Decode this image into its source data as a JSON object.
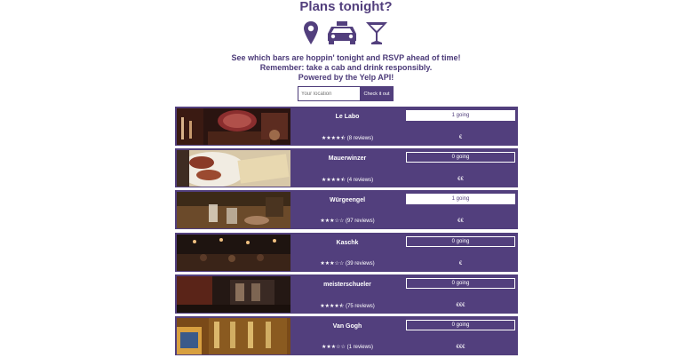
{
  "header": {
    "title": "Plans tonight?",
    "line1": "See which bars are hoppin' tonight and RSVP ahead of time!",
    "line2": "Remember: take a cab and drink responsibly.",
    "line3": "Powered by the Yelp API!"
  },
  "icons": [
    "map-marker-icon",
    "taxi-icon",
    "cocktail-icon"
  ],
  "search": {
    "placeholder": "Your location",
    "button_label": "Check it out"
  },
  "colors": {
    "brand": "#523f7d",
    "card": "#523f7d",
    "text": "#ffffff"
  },
  "bars": [
    {
      "name": "Le Labo",
      "stars": "★★★★⯪",
      "reviews": "(8 reviews)",
      "going": "1 going",
      "active": true,
      "price": "€"
    },
    {
      "name": "Mauerwinzer",
      "stars": "★★★★⯪",
      "reviews": "(4 reviews)",
      "going": "0 going",
      "active": false,
      "price": "€€"
    },
    {
      "name": "Würgeengel",
      "stars": "★★★☆☆",
      "reviews": "(97 reviews)",
      "going": "1 going",
      "active": true,
      "price": "€€"
    },
    {
      "name": "Kaschk",
      "stars": "★★★☆☆",
      "reviews": "(39 reviews)",
      "going": "0 going",
      "active": false,
      "price": "€"
    },
    {
      "name": "meisterschueler",
      "stars": "★★★★⯪",
      "reviews": "(75 reviews)",
      "going": "0 going",
      "active": false,
      "price": "€€€"
    },
    {
      "name": "Van Gogh",
      "stars": "★★★☆☆",
      "reviews": "(1 reviews)",
      "going": "0 going",
      "active": false,
      "price": "€€€"
    }
  ]
}
